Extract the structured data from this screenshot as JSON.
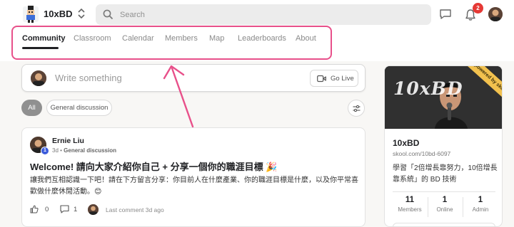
{
  "header": {
    "group_name": "10xBD",
    "search_placeholder": "Search",
    "notification_count": "2",
    "icons": [
      "group-logo-icon",
      "switcher-chevron-icon",
      "search-icon",
      "chat-icon",
      "bell-icon"
    ]
  },
  "nav": {
    "tabs": [
      {
        "label": "Community",
        "active": true
      },
      {
        "label": "Classroom",
        "active": false
      },
      {
        "label": "Calendar",
        "active": false
      },
      {
        "label": "Members",
        "active": false
      },
      {
        "label": "Map",
        "active": false
      },
      {
        "label": "Leaderboards",
        "active": false
      },
      {
        "label": "About",
        "active": false
      }
    ]
  },
  "compose": {
    "placeholder": "Write something",
    "go_live_label": "Go Live"
  },
  "filters": {
    "chips": [
      "All",
      "General discussion"
    ],
    "selected": "All"
  },
  "post": {
    "author": "Ernie Liu",
    "level": "1",
    "age": "3d",
    "category": "General discussion",
    "title": "Welcome! 請向大家介紹你自己 + 分享一個你的職涯目標 🎉",
    "body": "讓我們互相認識一下吧！請在下方留言分享：你目前人在什麼產業、你的職涯目標是什麼，以及你平常喜歡做什麼休閒活動。😊",
    "likes": "0",
    "comments": "1",
    "last_comment": "Last comment 3d ago"
  },
  "sidebar": {
    "cover_text": "10xBD",
    "ribbon": "powered by skool",
    "name": "10xBD",
    "url": "skool.com/10bd-6097",
    "description": "學習「2倍增長靠努力，10倍增長靠系統」的 BD 技術",
    "stats": [
      {
        "value": "11",
        "label": "Members"
      },
      {
        "value": "1",
        "label": "Online"
      },
      {
        "value": "1",
        "label": "Admin"
      }
    ]
  },
  "colors": {
    "highlight": "#e8508a",
    "badge": "#e53935",
    "level_badge": "#3b5bdb"
  }
}
